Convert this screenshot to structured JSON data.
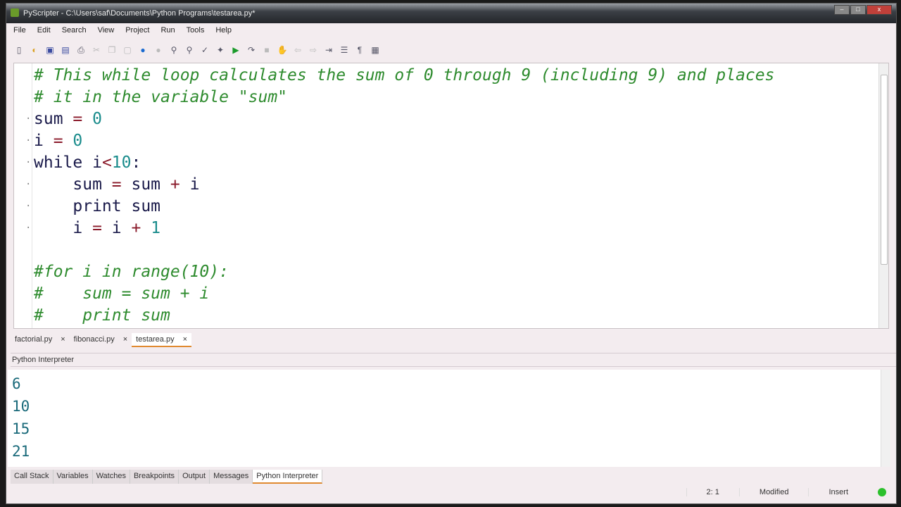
{
  "title": "PyScripter - C:\\Users\\saf\\Documents\\Python Programs\\testarea.py*",
  "menu": [
    "File",
    "Edit",
    "Search",
    "View",
    "Project",
    "Run",
    "Tools",
    "Help"
  ],
  "editor_tabs": [
    {
      "label": "factorial.py"
    },
    {
      "label": "fibonacci.py"
    },
    {
      "label": "testarea.py",
      "active": true
    }
  ],
  "interpreter_title": "Python Interpreter",
  "output": [
    "6",
    "10",
    "15",
    "21"
  ],
  "bottom_tabs": [
    "Call Stack",
    "Variables",
    "Watches",
    "Breakpoints",
    "Output",
    "Messages",
    "Python Interpreter"
  ],
  "status": {
    "position": "2: 1",
    "modified": "Modified",
    "mode": "Insert"
  },
  "close_glyph": "×"
}
